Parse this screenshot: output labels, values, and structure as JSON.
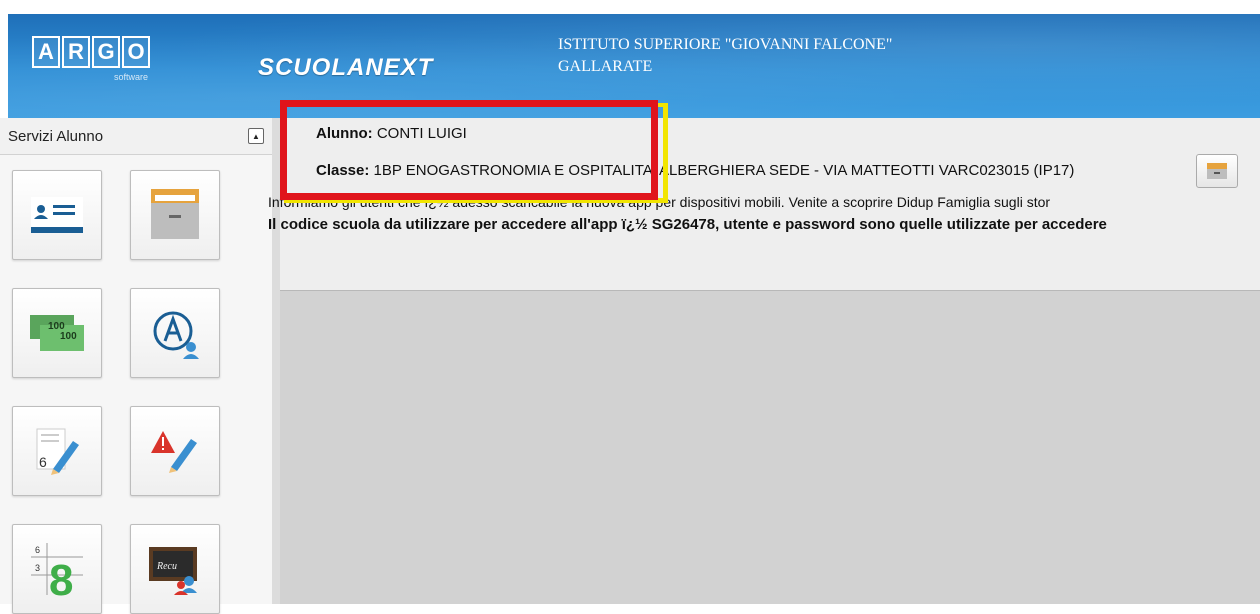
{
  "header": {
    "logo_letters": [
      "A",
      "R",
      "G",
      "O"
    ],
    "logo_sub": "software",
    "brand": "SCUOLANEXT",
    "school_name": "ISTITUTO SUPERIORE \"GIOVANNI FALCONE\"",
    "school_city": "GALLARATE"
  },
  "sidebar": {
    "title": "Servizi Alunno",
    "tiles": [
      {
        "name": "anagrafe",
        "icon": "student-card-icon"
      },
      {
        "name": "archivio",
        "icon": "drawer-icon"
      },
      {
        "name": "tasse",
        "icon": "money-icon"
      },
      {
        "name": "assenze",
        "icon": "absence-icon"
      },
      {
        "name": "voti",
        "icon": "grade-pencil-icon"
      },
      {
        "name": "note",
        "icon": "warning-pencil-icon"
      },
      {
        "name": "scrutinio",
        "icon": "scrutinio-icon"
      },
      {
        "name": "recupero",
        "icon": "recovery-board-icon"
      }
    ],
    "tile_texts": {
      "money_value": "100",
      "scrutinio_big": "8",
      "scrutinio_small_a": "6",
      "scrutinio_small_b": "3",
      "recupero_board": "Recu",
      "voti_number": "6"
    }
  },
  "student": {
    "alunno_label": "Alunno:",
    "alunno_value": "CONTI LUIGI",
    "classe_label": "Classe:",
    "classe_value": "1BP ENOGASTRONOMIA E OSPITALITA' ALBERGHIERA SEDE - VIA MATTEOTTI VARC023015 (IP17)"
  },
  "notice": {
    "line1": "Informiamo gli utenti che ï¿½ adesso scaricabile la nuova app per dispositivi mobili. Venite a scoprire Didup Famiglia sugli stor",
    "line2": "Il codice scuola da utilizzare per accedere all'app ï¿½ SG26478, utente e password sono quelle utilizzate per accedere"
  },
  "colors": {
    "header_blue": "#2f8fd6",
    "highlight_red": "#e0141b",
    "highlight_yellow": "#f2e500",
    "content_grey": "#d2d2d2"
  }
}
